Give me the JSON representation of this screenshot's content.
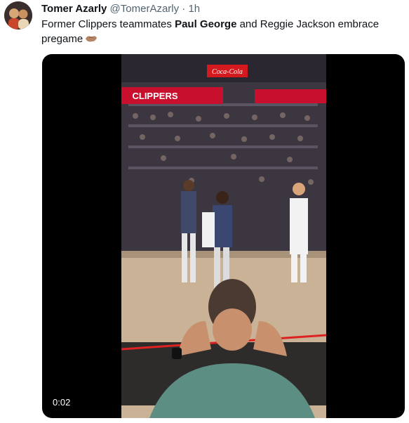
{
  "tweet": {
    "author_name": "Tomer Azarly",
    "handle": "@TomerAzarly",
    "separator": "·",
    "time": "1h",
    "text_prefix": "Former Clippers teammates ",
    "text_bold": "Paul George",
    "text_suffix": " and Reggie Jackson embrace pregame",
    "emoji_icon": "handshake-emoji-icon"
  },
  "media": {
    "type": "video",
    "timestamp": "0:02",
    "arena_signs": [
      "Coca-Cola",
      "CLIPPERS"
    ]
  },
  "colors": {
    "text_primary": "#0f1419",
    "text_secondary": "#536471",
    "video_background": "#000000"
  }
}
